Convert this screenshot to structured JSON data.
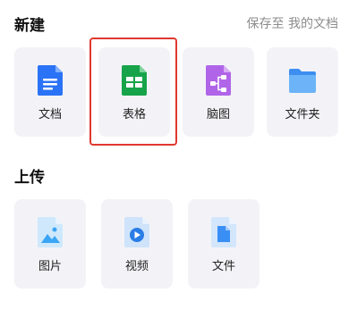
{
  "new_section": {
    "title": "新建",
    "save_hint": "保存至 我的文档",
    "items": [
      {
        "label": "文档",
        "icon": "document-icon",
        "color": "#2b73f6"
      },
      {
        "label": "表格",
        "icon": "spreadsheet-icon",
        "color": "#17a34a"
      },
      {
        "label": "脑图",
        "icon": "mindmap-icon",
        "color": "#b065e8"
      },
      {
        "label": "文件夹",
        "icon": "folder-icon",
        "color": "#5aa9f5"
      }
    ]
  },
  "upload_section": {
    "title": "上传",
    "items": [
      {
        "label": "图片",
        "icon": "image-icon",
        "color": "#3ba5f5"
      },
      {
        "label": "视频",
        "icon": "video-icon",
        "color": "#2b7de6"
      },
      {
        "label": "文件",
        "icon": "file-icon",
        "color": "#3a8ff5"
      }
    ]
  },
  "highlight_color": "#e0382f"
}
